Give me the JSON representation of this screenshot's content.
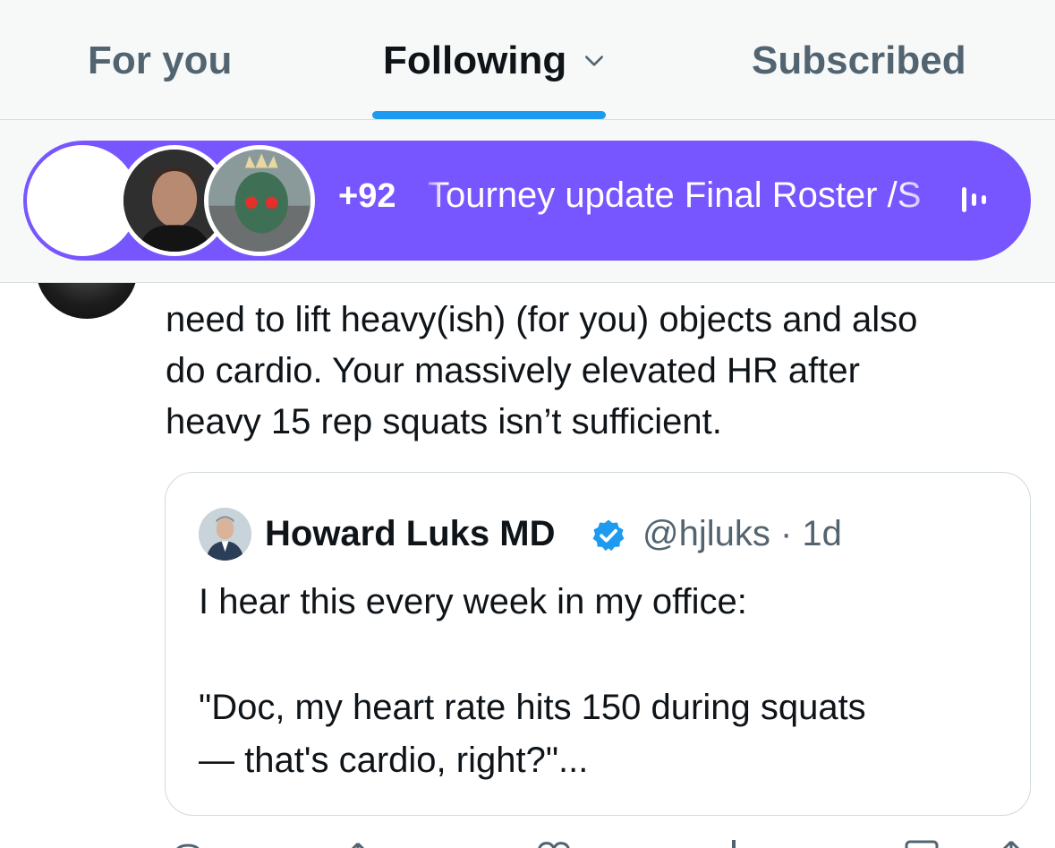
{
  "tabs": {
    "for_you": "For you",
    "following": "Following",
    "subscribed": "Subscribed",
    "active": "Following"
  },
  "space": {
    "listener_count": "+92",
    "title": "Tourney update Final Roster /S",
    "color": "#7856ff"
  },
  "tweet": {
    "lines": [
      "need to lift heavy(ish) (for you) objects and also",
      "do cardio. Your massively elevated HR after",
      "heavy 15 rep squats isn’t sufficient."
    ]
  },
  "quote": {
    "author_name": "Howard Luks MD",
    "handle": "@hjluks",
    "time": "· 1d",
    "verified": true,
    "body_line1": "I hear this every week in my office:",
    "body_line2": "\"Doc, my heart rate hits 150 during squats",
    "body_line3": "— that's cardio, right?\"..."
  },
  "colors": {
    "accent": "#1d9bf0",
    "text_primary": "#0f1419",
    "text_secondary": "#536471",
    "border": "#cfd9de"
  },
  "icons": {
    "following_dropdown": "chevron-down-icon",
    "space_audio": "audio-bars-icon",
    "verified": "verified-badge-icon",
    "actions": [
      "reply-icon",
      "repost-icon",
      "like-icon",
      "views-icon",
      "bookmark-icon",
      "share-icon"
    ]
  }
}
